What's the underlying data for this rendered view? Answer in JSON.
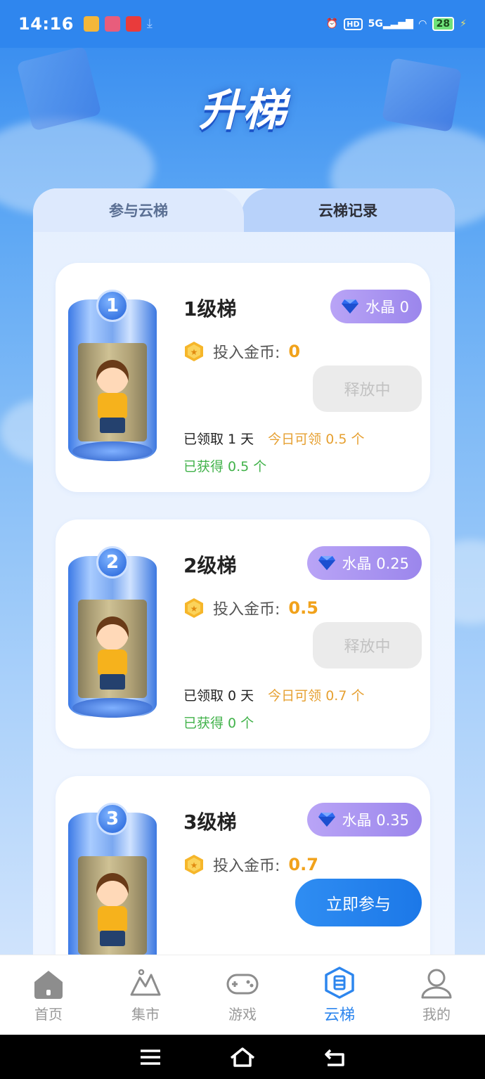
{
  "status_bar": {
    "time": "14:16",
    "network": "5G",
    "hd": "HD",
    "battery": "28"
  },
  "hero": {
    "title": "升梯"
  },
  "tabs": [
    {
      "label": "参与云梯",
      "active": true
    },
    {
      "label": "云梯记录",
      "active": false
    }
  ],
  "cards": [
    {
      "badge": "1",
      "level": "1级梯",
      "crystal": "水晶 0",
      "coin_label": "投入金币:",
      "coin_value": "0",
      "button": "释放中",
      "claimed": "已领取 1 天",
      "today": "今日可领 0.5 个",
      "earned": "已获得 0.5 个"
    },
    {
      "badge": "2",
      "level": "2级梯",
      "crystal": "水晶 0.25",
      "coin_label": "投入金币:",
      "coin_value": "0.5",
      "button": "释放中",
      "claimed": "已领取 0 天",
      "today": "今日可领 0.7 个",
      "earned": "已获得 0 个"
    },
    {
      "badge": "3",
      "level": "3级梯",
      "crystal": "水晶 0.35",
      "coin_label": "投入金币:",
      "coin_value": "0.7",
      "button": "立即参与"
    }
  ],
  "bottom_nav": [
    {
      "label": "首页",
      "icon": "home-icon",
      "active": false
    },
    {
      "label": "集市",
      "icon": "market-icon",
      "active": false
    },
    {
      "label": "游戏",
      "icon": "gamepad-icon",
      "active": false
    },
    {
      "label": "云梯",
      "icon": "ladder-icon",
      "active": true
    },
    {
      "label": "我的",
      "icon": "profile-icon",
      "active": false
    }
  ],
  "colors": {
    "accent": "#2d86ee",
    "coin": "#f1a21b",
    "earned": "#41b24a",
    "today": "#e6a031",
    "crystal_pill": "#a793ef"
  }
}
